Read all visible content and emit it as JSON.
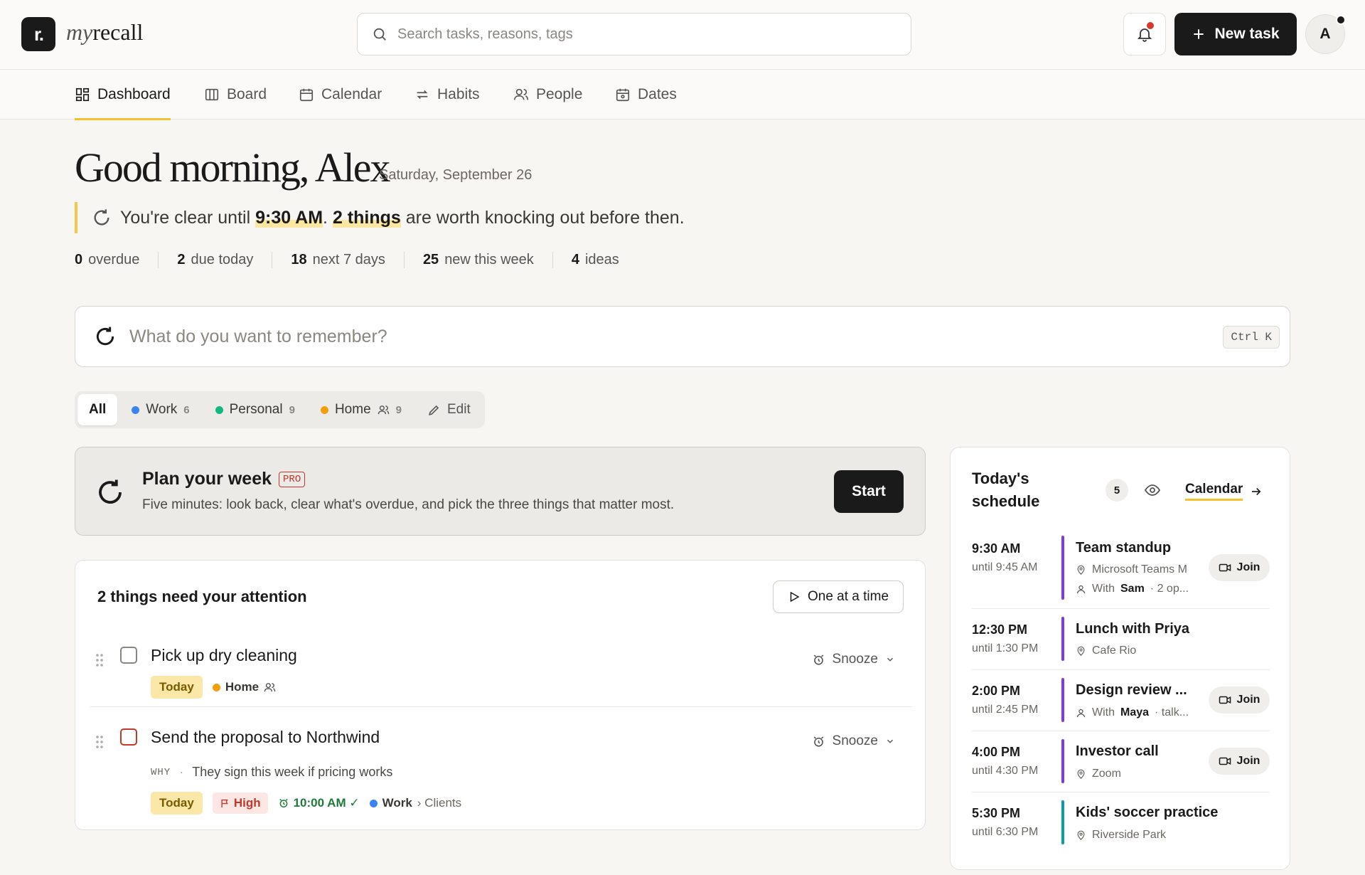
{
  "app": {
    "logo_letter": "r.",
    "name_light": "my",
    "name_bold": "recall"
  },
  "search": {
    "placeholder": "Search tasks, reasons, tags"
  },
  "header": {
    "new_task_label": "New task",
    "avatar_letter": "A"
  },
  "nav": {
    "items": [
      {
        "label": "Dashboard",
        "icon": "dashboard-icon"
      },
      {
        "label": "Board",
        "icon": "board-icon"
      },
      {
        "label": "Calendar",
        "icon": "calendar-icon"
      },
      {
        "label": "Habits",
        "icon": "repeat-icon"
      },
      {
        "label": "People",
        "icon": "people-icon"
      },
      {
        "label": "Dates",
        "icon": "dates-icon"
      }
    ],
    "active": "Dashboard"
  },
  "greeting": {
    "title": "Good morning, Alex",
    "date": "Saturday, September 26",
    "clear_prefix": "You're clear until",
    "clear_time": "9:30 AM",
    "clear_mid": ".",
    "clear_count": "2 things",
    "clear_suffix": "are worth knocking out before then."
  },
  "stats": [
    {
      "value": "0",
      "label": "overdue"
    },
    {
      "value": "2",
      "label": "due today"
    },
    {
      "value": "18",
      "label": "next 7 days"
    },
    {
      "value": "25",
      "label": "new this week"
    },
    {
      "value": "4",
      "label": "ideas"
    }
  ],
  "capture": {
    "placeholder": "What do you want to remember?",
    "shortcut": "Ctrl K"
  },
  "filters": {
    "all": "All",
    "lists": [
      {
        "label": "Work",
        "count": "6",
        "color": "#3b82f6"
      },
      {
        "label": "Personal",
        "count": "9",
        "color": "#10b981"
      },
      {
        "label": "Home",
        "count": "9",
        "color": "#f59e0b",
        "shared": true
      }
    ],
    "edit": "Edit"
  },
  "plan": {
    "title": "Plan your week",
    "badge": "PRO",
    "subtitle": "Five minutes: look back, clear what's overdue, and pick the three things that matter most.",
    "button": "Start"
  },
  "attention": {
    "title": "2 things need your attention",
    "one_at_a_time": "One at a time",
    "snooze": "Snooze",
    "tasks": [
      {
        "name": "Pick up dry cleaning",
        "today": "Today",
        "list": "Home",
        "list_color": "#f59e0b"
      },
      {
        "name": "Send the proposal to Northwind",
        "why_label": "WHY",
        "why": "They sign this week if pricing works",
        "today": "Today",
        "priority": "High",
        "time": "10:00 AM ✓",
        "list": "Work",
        "sublist": "› Clients",
        "list_color": "#3b82f6"
      }
    ]
  },
  "schedule": {
    "title": "Today's schedule",
    "count": "5",
    "calendar_link": "Calendar",
    "join": "Join",
    "events": [
      {
        "start": "9:30 AM",
        "end": "until 9:45 AM",
        "name": "Team standup",
        "location": "Microsoft Teams M",
        "with_prefix": "With",
        "with": "Sam",
        "with_suffix": "· 2 op...",
        "color": "#7c3aed"
      },
      {
        "start": "12:30 PM",
        "end": "until 1:30 PM",
        "name": "Lunch with Priya",
        "location": "Cafe Rio",
        "color": "#7c3aed"
      },
      {
        "start": "2:00 PM",
        "end": "until 2:45 PM",
        "name": "Design review ...",
        "with_prefix": "With",
        "with": "Maya",
        "with_suffix": "· talk...",
        "color": "#7c3aed"
      },
      {
        "start": "4:00 PM",
        "end": "until 4:30 PM",
        "name": "Investor call",
        "location": "Zoom",
        "color": "#7c3aed"
      },
      {
        "start": "5:30 PM",
        "end": "until 6:30 PM",
        "name": "Kids' soccer practice",
        "location": "Riverside Park",
        "color": "#0e9aa7"
      }
    ]
  }
}
